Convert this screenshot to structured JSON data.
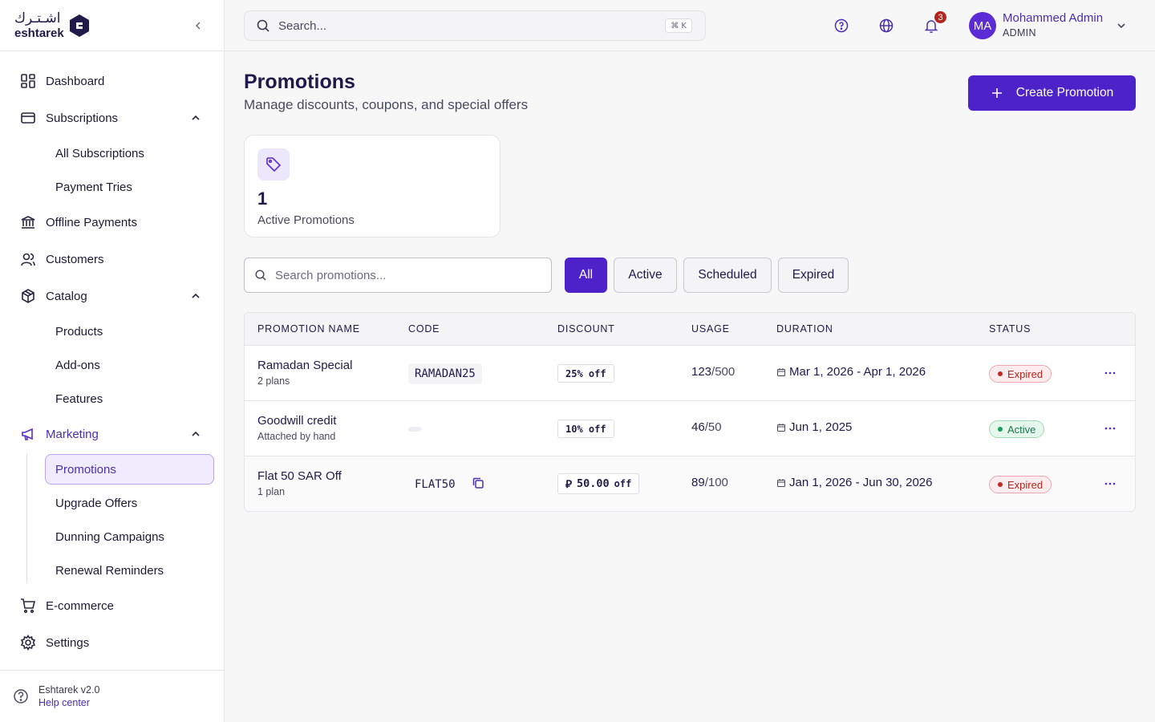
{
  "brand": {
    "arabic": "اشـتـرك",
    "english": "eshtarek"
  },
  "sidebar": {
    "items": [
      {
        "label": "Dashboard"
      },
      {
        "label": "Subscriptions",
        "children": [
          "All Subscriptions",
          "Payment Tries"
        ]
      },
      {
        "label": "Offline Payments"
      },
      {
        "label": "Customers"
      },
      {
        "label": "Catalog",
        "children": [
          "Products",
          "Add-ons",
          "Features"
        ]
      },
      {
        "label": "Marketing",
        "children": [
          "Promotions",
          "Upgrade Offers",
          "Dunning Campaigns",
          "Renewal Reminders"
        ]
      },
      {
        "label": "E-commerce"
      },
      {
        "label": "Settings"
      }
    ],
    "footer": {
      "version": "Eshtarek v2.0",
      "help": "Help center"
    }
  },
  "topbar": {
    "search_placeholder": "Search...",
    "shortcut": "⌘ K",
    "notifications_count": "3",
    "user": {
      "initials": "MA",
      "name": "Mohammed Admin",
      "role": "ADMIN"
    }
  },
  "page": {
    "title": "Promotions",
    "subtitle": "Manage discounts, coupons, and special offers",
    "create_label": "Create Promotion",
    "stat": {
      "value": "1",
      "label": "Active Promotions"
    },
    "search_placeholder": "Search promotions...",
    "filters": [
      "All",
      "Active",
      "Scheduled",
      "Expired"
    ],
    "active_filter": "All"
  },
  "table": {
    "columns": [
      "PROMOTION NAME",
      "CODE",
      "DISCOUNT",
      "USAGE",
      "DURATION",
      "STATUS"
    ],
    "rows": [
      {
        "name": "Ramadan Special",
        "sub": "2 plans",
        "code": "RAMADAN25",
        "discount": "25% off",
        "used": "123",
        "limit": "/500",
        "duration": "Mar 1, 2026 - Apr 1, 2026",
        "status": "Expired"
      },
      {
        "name": "Goodwill credit",
        "sub": "Attached by hand",
        "code": "",
        "discount": "10% off",
        "used": "46",
        "limit": "/50",
        "duration": "Jun 1, 2025",
        "status": "Active"
      },
      {
        "name": "Flat 50 SAR Off",
        "sub": "1 plan",
        "code": "FLAT50",
        "discount_currency": "⃁",
        "discount_amount": "50.00",
        "discount_suffix": "off",
        "used": "89",
        "limit": "/100",
        "duration": "Jan 1, 2026 - Jun 30, 2026",
        "status": "Expired"
      }
    ]
  },
  "colors": {
    "accent": "#4e22c9",
    "expired": "#b3261e",
    "active": "#18794e"
  }
}
